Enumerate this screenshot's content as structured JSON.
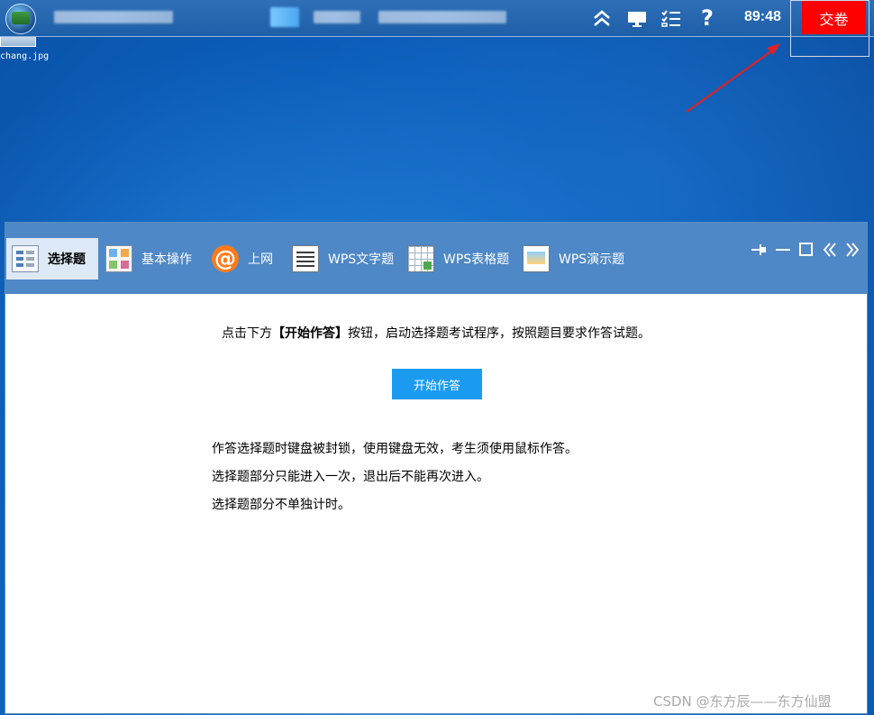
{
  "topbar": {
    "timer": "89:48",
    "submit_label": "交卷",
    "icons": [
      "collapse-up-icon",
      "monitor-icon",
      "checklist-icon",
      "help-icon"
    ],
    "help_glyph": "?"
  },
  "desktop": {
    "file_label": "chang.jpg"
  },
  "tabs": [
    {
      "label": "选择题",
      "icon": "choice-icon",
      "active": true
    },
    {
      "label": "基本操作",
      "icon": "basic-ops-icon",
      "active": false
    },
    {
      "label": "上网",
      "icon": "at-icon",
      "icon_glyph": "@",
      "active": false
    },
    {
      "label": "WPS文字题",
      "icon": "wps-writer-icon",
      "active": false
    },
    {
      "label": "WPS表格题",
      "icon": "wps-spreadsheet-icon",
      "active": false
    },
    {
      "label": "WPS演示题",
      "icon": "wps-presentation-icon",
      "active": false
    }
  ],
  "window_controls": [
    "pin-icon",
    "minimize-icon",
    "maximize-icon",
    "collapse-left-icon",
    "expand-right-icon"
  ],
  "main": {
    "instruction_prefix": "点击下方",
    "instruction_bold": "【开始作答】",
    "instruction_suffix": "按钮，启动选择题考试程序，按照题目要求作答试题。",
    "start_button": "开始作答",
    "notes": [
      "作答选择题时键盘被封锁，使用键盘无效，考生须使用鼠标作答。",
      "选择题部分只能进入一次，退出后不能再次进入。",
      "选择题部分不单独计时。"
    ]
  },
  "watermark": "CSDN @东方辰——东方仙盟",
  "colors": {
    "submit": "#ff0000",
    "start_button": "#1b9bf0",
    "tabbar": "#4f88c6",
    "annotation_arrow": "#e02020"
  }
}
